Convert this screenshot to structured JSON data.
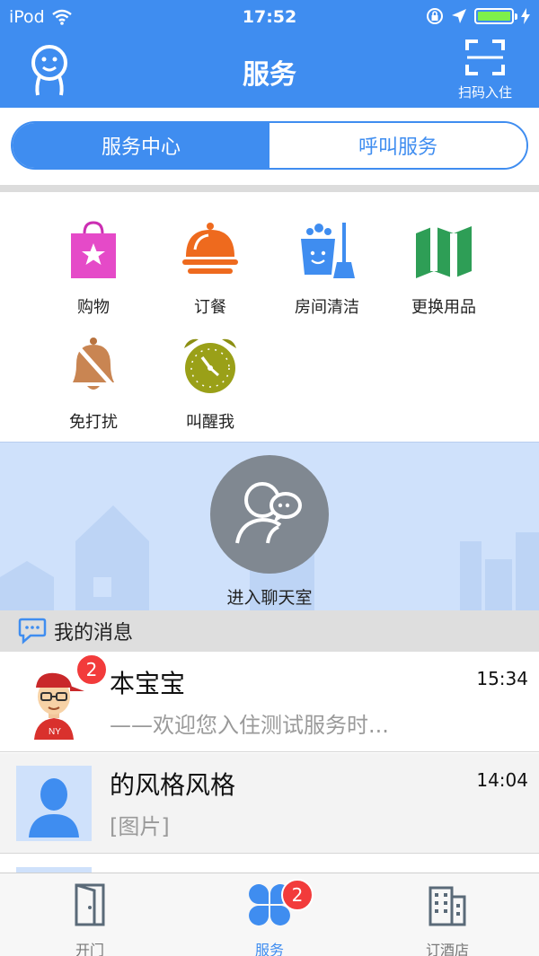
{
  "status_bar": {
    "carrier": "iPod",
    "time": "17:52"
  },
  "nav": {
    "title": "服务",
    "scan_label": "扫码入住"
  },
  "segments": {
    "left": "服务中心",
    "right": "呼叫服务"
  },
  "services": [
    {
      "label": "购物",
      "icon": "shopping-bag-icon"
    },
    {
      "label": "订餐",
      "icon": "food-cloche-icon"
    },
    {
      "label": "房间清洁",
      "icon": "cleaning-icon"
    },
    {
      "label": "更换用品",
      "icon": "folded-map-icon"
    },
    {
      "label": "免打扰",
      "icon": "bell-muted-icon"
    },
    {
      "label": "叫醒我",
      "icon": "alarm-clock-icon"
    }
  ],
  "chat_room": {
    "label": "进入聊天室"
  },
  "messages_header": {
    "title": "我的消息"
  },
  "messages": [
    {
      "name": "本宝宝",
      "time": "15:34",
      "preview": "——欢迎您入住测试服务时...",
      "badge": "2"
    },
    {
      "name": "的风格风格",
      "time": "14:04",
      "preview": "[图片]"
    }
  ],
  "tabs": [
    {
      "label": "开门",
      "icon": "door-icon"
    },
    {
      "label": "服务",
      "icon": "clover-icon",
      "badge": "2",
      "active": true
    },
    {
      "label": "订酒店",
      "icon": "building-icon"
    }
  ],
  "colors": {
    "brand": "#3f8df0",
    "badge": "#f23b3b",
    "battery": "#7ef04b"
  }
}
